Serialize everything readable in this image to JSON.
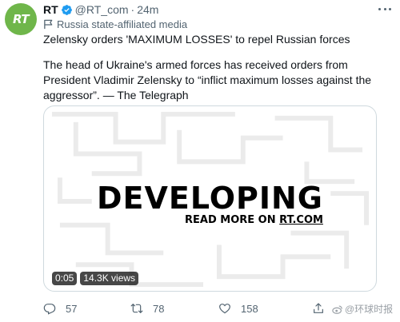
{
  "author": {
    "avatar_text": "RT",
    "display_name": "RT",
    "handle": "@RT_com",
    "separator": "·",
    "time": "24m",
    "label": "Russia state-affiliated media"
  },
  "tweet": {
    "headline": "Zelensky orders 'MAXIMUM LOSSES' to repel Russian forces",
    "body": "The head of Ukraine's armed forces has received orders from President Vladimir Zelensky to “inflict maximum losses against the aggressor”. — The Telegraph"
  },
  "media": {
    "title": "DEVELOPING",
    "read_more_prefix": "READ MORE ON ",
    "read_more_link": "RT.COM",
    "duration": "0:05",
    "views": "14.3K views"
  },
  "actions": {
    "replies": "57",
    "retweets": "78",
    "likes": "158"
  },
  "watermark": "@环球时报",
  "colors": {
    "avatar_bg": "#6fb64a",
    "verified": "#1d9bf0",
    "secondary_text": "#536471"
  },
  "icons": [
    "verified-badge-icon",
    "more-icon",
    "flag-icon",
    "reply-icon",
    "retweet-icon",
    "like-icon",
    "share-icon",
    "weibo-icon"
  ]
}
